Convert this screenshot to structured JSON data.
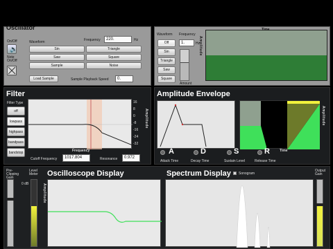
{
  "oscillator": {
    "title": "Oscillator",
    "onoff_label": "On/Off",
    "note_onoff_label": "Note\nOn/Off",
    "waveform_label": "Waveform",
    "frequency_label": "Frequency",
    "frequency_value": "220.",
    "frequency_unit": "Hz",
    "waveforms": [
      "Sin",
      "Triangle",
      "Saw",
      "Square",
      "Sample",
      "Noise"
    ],
    "load_sample_label": "Load Sample",
    "playback_speed_label": "Sample Playback Speed",
    "playback_speed_value": "0."
  },
  "lfo": {
    "waveform_label": "Waveform",
    "frequency_label": "Frequency",
    "frequency_value": "1.",
    "frequency_unit": "Hz",
    "options": [
      "Off",
      "Sin",
      "Triangle",
      "Saw",
      "Square"
    ],
    "amount_label": "Amount",
    "amplitude_label": "Amplitude",
    "time_label": "Time"
  },
  "filter": {
    "title": "Filter",
    "type_label": "Filter Type",
    "types": [
      "off",
      "lowpass",
      "highpass",
      "bandpass",
      "bandstop"
    ],
    "frequency_label": "Frequency",
    "amplitude_label": "Amplitude",
    "cutoff_label": "Cutoff Frequency",
    "cutoff_value": "1017.804",
    "resonance_label": "Resonance",
    "resonance_value": "0.972",
    "y_ticks": [
      "16",
      "8",
      "0",
      "-8",
      "-16",
      "-24",
      "-32"
    ]
  },
  "envelope": {
    "title": "Amplitude Envelope",
    "amplitude_label": "Amplitude",
    "time_label": "Time",
    "letters": [
      "A",
      "D",
      "S",
      "R"
    ],
    "controls": [
      "Attack Time",
      "Decay Time",
      "Sustain Level",
      "Release Time"
    ]
  },
  "mixer": {
    "pre_gain_label": "Pre-Clipping Gain",
    "level_meter_label": "Level Meter",
    "output_gain_label": "Output Gain",
    "db_label": "0 dB"
  },
  "oscilloscope": {
    "title": "Oscilloscope Display",
    "amplitude_label": "Amplitude"
  },
  "spectrum": {
    "title": "Spectrum Display",
    "sonogram_label": "Sonogram"
  },
  "colors": {
    "panel": "#9a9a9a",
    "dark": "#1b1d1f",
    "green": "#2f8a3a",
    "bright_green": "#3fe05a",
    "yellow": "#f2f23c",
    "olive": "#6d7a2a"
  }
}
